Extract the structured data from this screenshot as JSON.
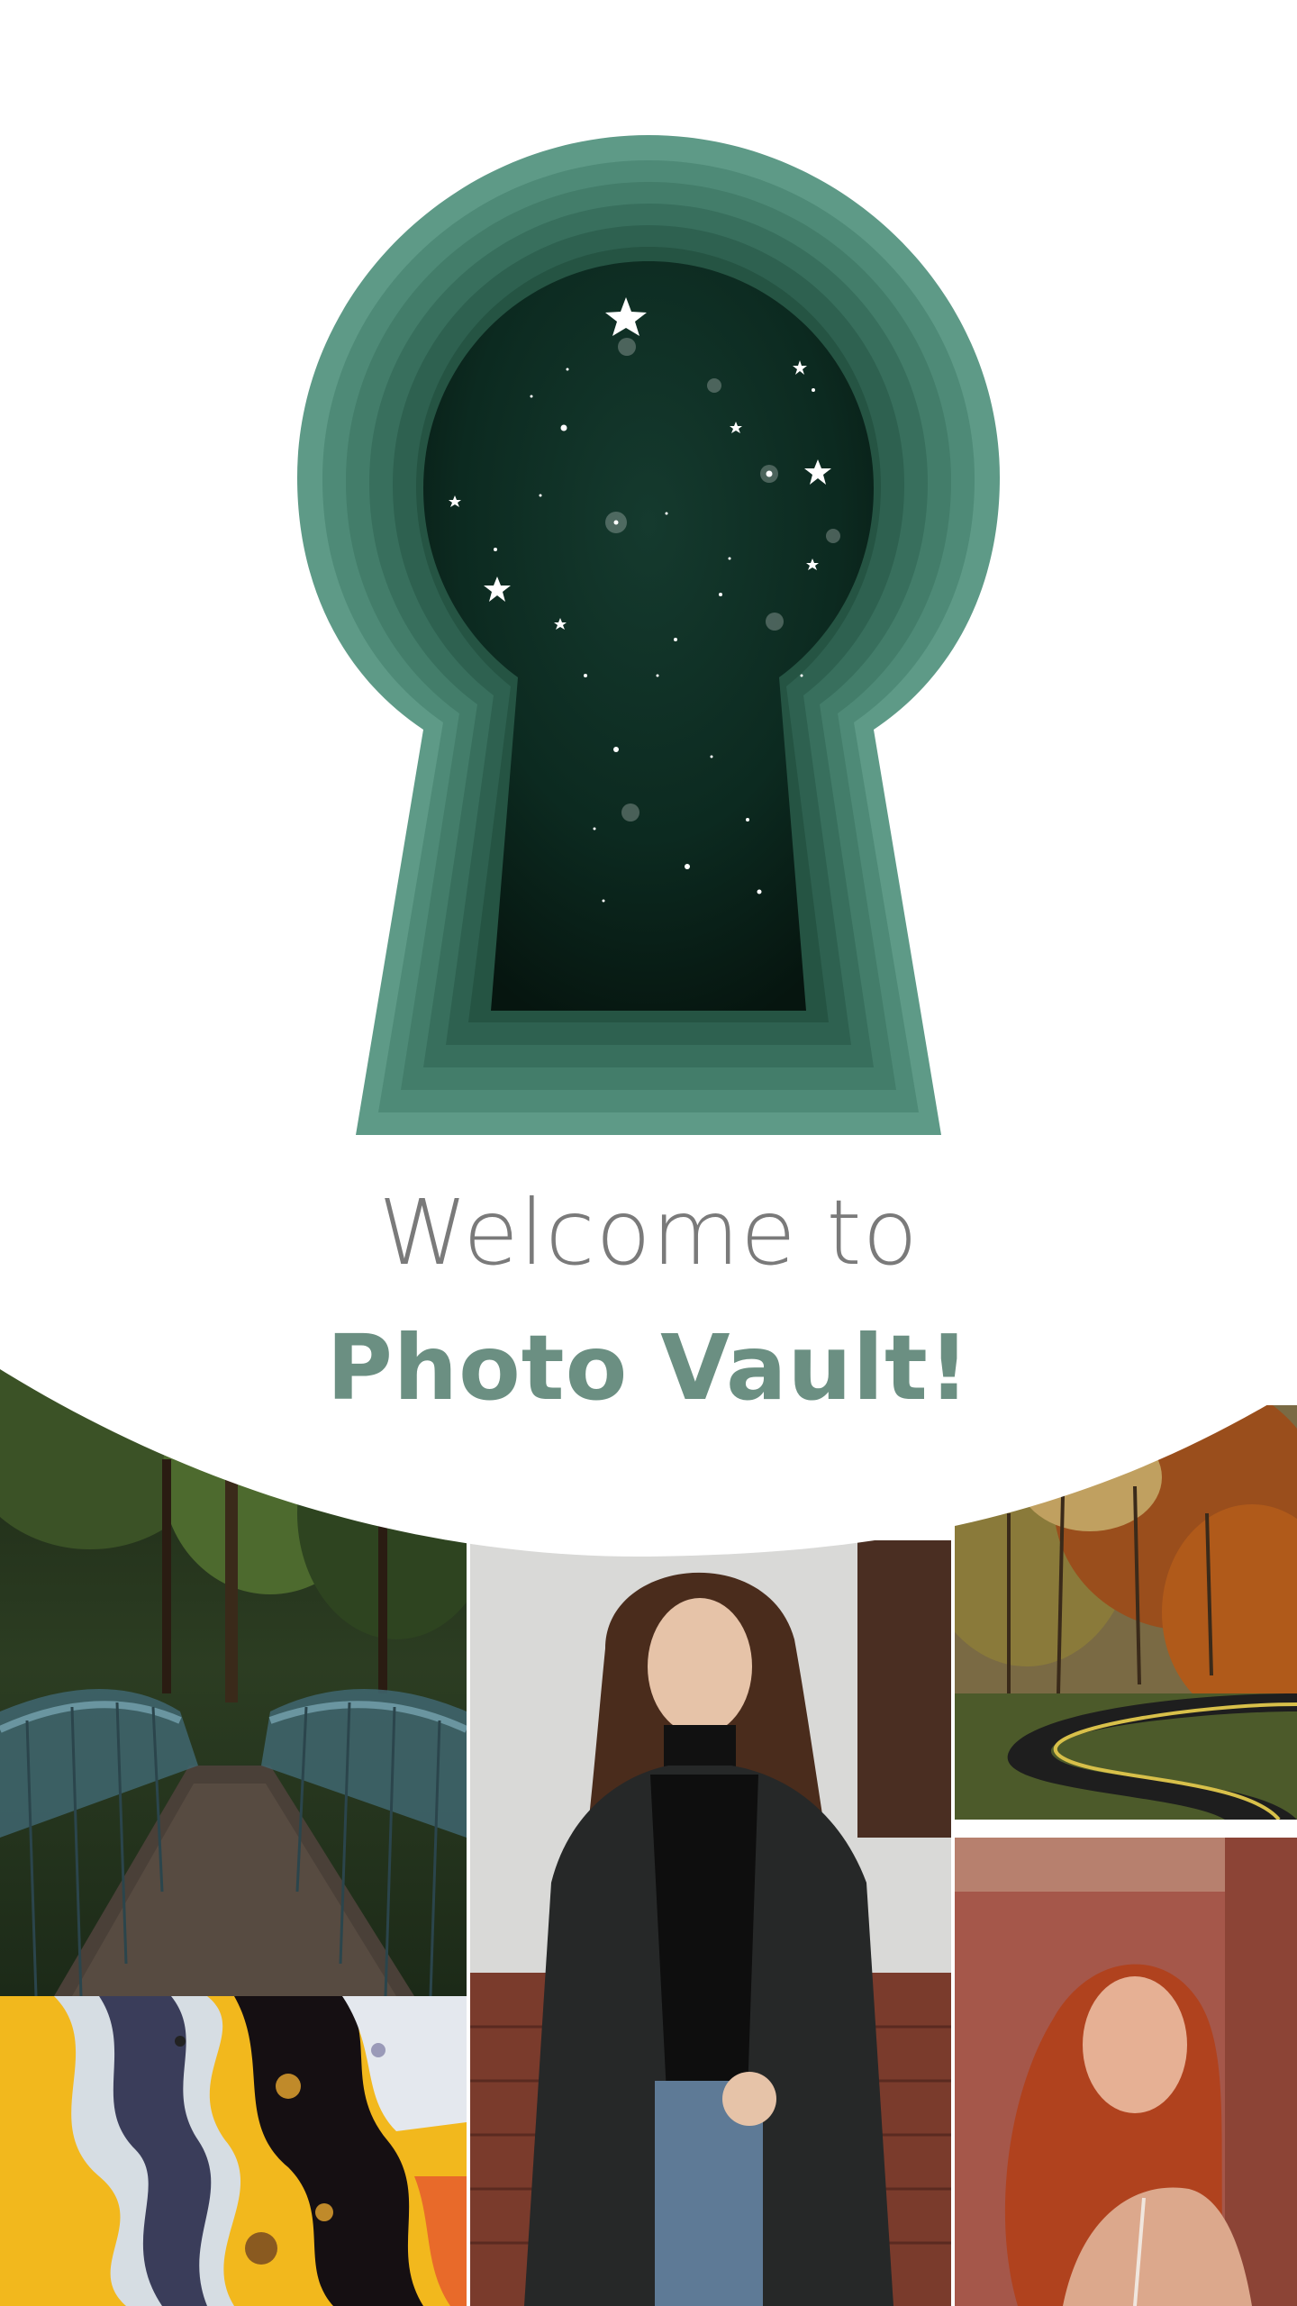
{
  "welcome": {
    "line1": "Welcome to",
    "title": "Photo Vault!"
  },
  "colors": {
    "keyhole_outer": "#5e9a87",
    "keyhole_inner": "#0a2018",
    "title": "#6b8f82",
    "subtitle": "#7a7a7a",
    "background": "#ffffff"
  },
  "keyhole": {
    "icon": "keyhole-with-starry-night"
  },
  "gallery": {
    "photos": [
      {
        "name": "forest-bridge"
      },
      {
        "name": "abstract-fluid-art"
      },
      {
        "name": "woman-in-leather-coat"
      },
      {
        "name": "autumn-winding-road"
      },
      {
        "name": "redhead-portrait"
      }
    ]
  }
}
